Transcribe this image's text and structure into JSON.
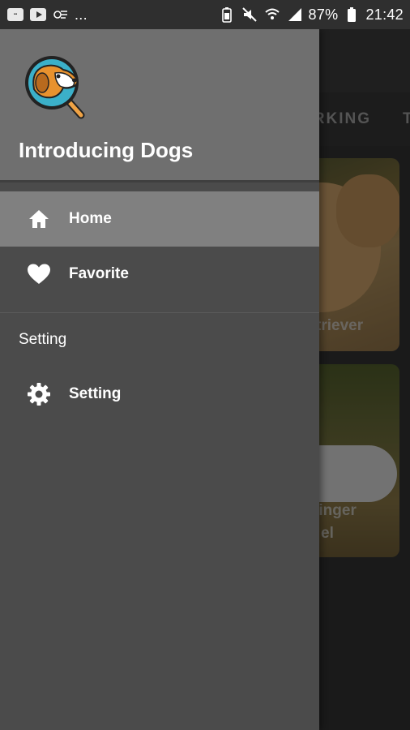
{
  "status_bar": {
    "left_icons": [
      "app-notification-icon",
      "youtube-icon",
      "cast-icon"
    ],
    "more": "...",
    "right_icons": [
      "battery-saver-icon",
      "mute-icon",
      "wifi-icon",
      "signal-icon"
    ],
    "battery": "87%",
    "time": "21:42"
  },
  "background_app": {
    "tabs": [
      "ORKING",
      "T"
    ],
    "cards": [
      {
        "label": "triever"
      },
      {
        "label_line1": "ringer",
        "label_line2": "el"
      }
    ]
  },
  "drawer": {
    "title": "Introducing Dogs",
    "logo": "dog-magnifier-logo",
    "items": [
      {
        "label": "Home",
        "icon": "home-icon",
        "active": true
      },
      {
        "label": "Favorite",
        "icon": "heart-icon",
        "active": false
      }
    ],
    "section_title": "Setting",
    "section_items": [
      {
        "label": "Setting",
        "icon": "gear-icon"
      }
    ]
  },
  "colors": {
    "drawer_bg": "#4b4b4b",
    "header_bg": "#6f6f6f",
    "active_item_bg": "#808080",
    "logo_orange": "#e8922e",
    "logo_blue": "#3bb0c9"
  }
}
